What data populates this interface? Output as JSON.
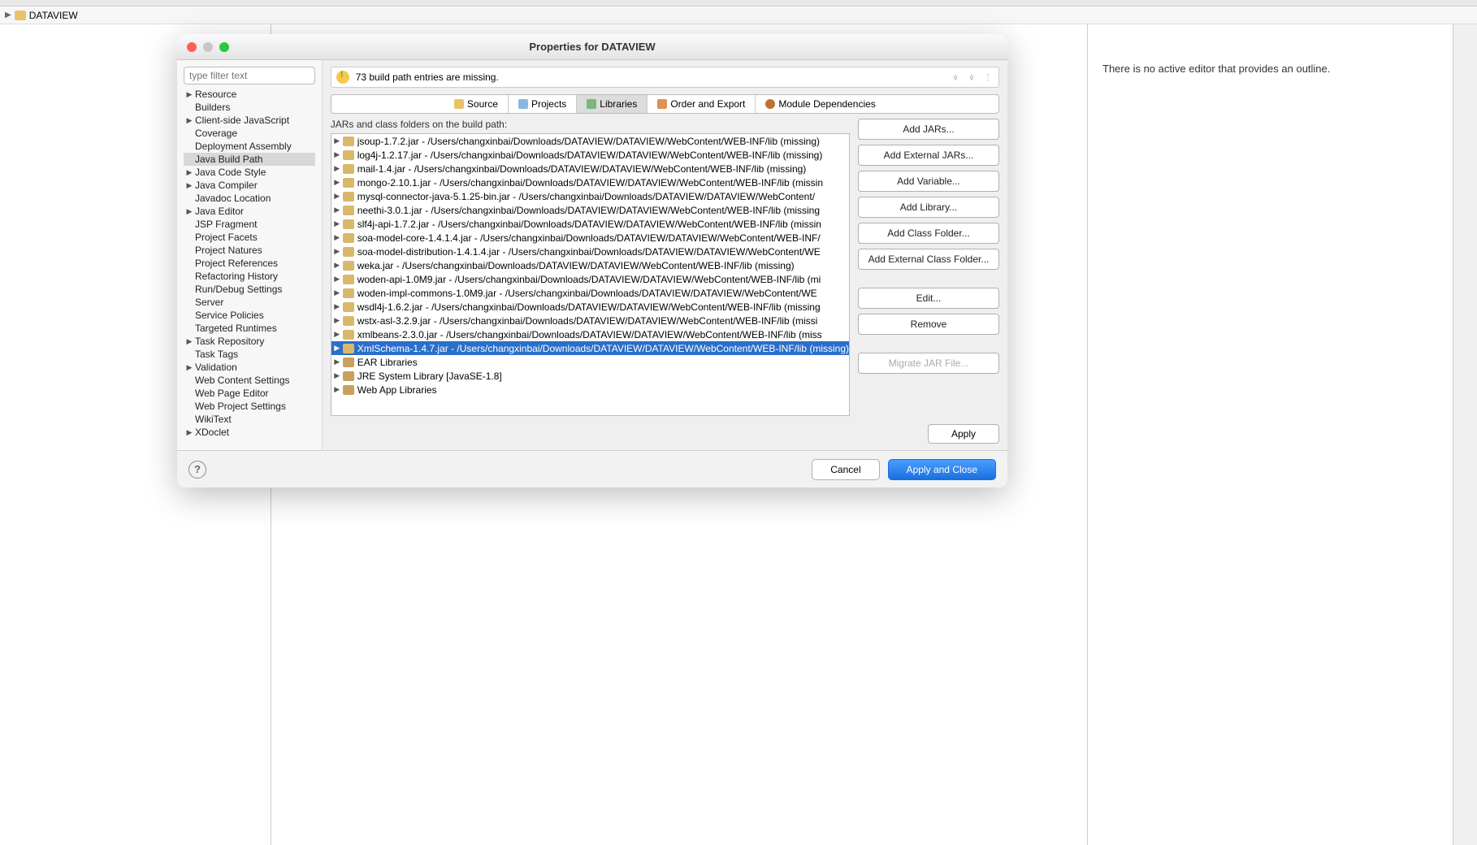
{
  "ide": {
    "project_name": "DATAVIEW",
    "outline_text": "There is no active editor that provides an outline."
  },
  "dialog": {
    "title": "Properties for DATAVIEW",
    "filter_placeholder": "type filter text",
    "alert_text": "73 build path entries are missing.",
    "sidebar": [
      {
        "label": "Resource",
        "expandable": true
      },
      {
        "label": "Builders",
        "expandable": false
      },
      {
        "label": "Client-side JavaScript",
        "expandable": true
      },
      {
        "label": "Coverage",
        "expandable": false
      },
      {
        "label": "Deployment Assembly",
        "expandable": false
      },
      {
        "label": "Java Build Path",
        "expandable": false,
        "selected": true
      },
      {
        "label": "Java Code Style",
        "expandable": true
      },
      {
        "label": "Java Compiler",
        "expandable": true
      },
      {
        "label": "Javadoc Location",
        "expandable": false
      },
      {
        "label": "Java Editor",
        "expandable": true
      },
      {
        "label": "JSP Fragment",
        "expandable": false
      },
      {
        "label": "Project Facets",
        "expandable": false
      },
      {
        "label": "Project Natures",
        "expandable": false
      },
      {
        "label": "Project References",
        "expandable": false
      },
      {
        "label": "Refactoring History",
        "expandable": false
      },
      {
        "label": "Run/Debug Settings",
        "expandable": false
      },
      {
        "label": "Server",
        "expandable": false
      },
      {
        "label": "Service Policies",
        "expandable": false
      },
      {
        "label": "Targeted Runtimes",
        "expandable": false
      },
      {
        "label": "Task Repository",
        "expandable": true
      },
      {
        "label": "Task Tags",
        "expandable": false
      },
      {
        "label": "Validation",
        "expandable": true
      },
      {
        "label": "Web Content Settings",
        "expandable": false
      },
      {
        "label": "Web Page Editor",
        "expandable": false
      },
      {
        "label": "Web Project Settings",
        "expandable": false
      },
      {
        "label": "WikiText",
        "expandable": false
      },
      {
        "label": "XDoclet",
        "expandable": true
      }
    ],
    "tabs": [
      {
        "label": "Source",
        "icon": "ti-src"
      },
      {
        "label": "Projects",
        "icon": "ti-proj"
      },
      {
        "label": "Libraries",
        "icon": "ti-lib",
        "active": true
      },
      {
        "label": "Order and Export",
        "icon": "ti-order"
      },
      {
        "label": "Module Dependencies",
        "icon": "ti-mod"
      }
    ],
    "list_label": "JARs and class folders on the build path:",
    "jars": [
      {
        "text": "jsoup-1.7.2.jar - /Users/changxinbai/Downloads/DATAVIEW/DATAVIEW/WebContent/WEB-INF/lib (missing)"
      },
      {
        "text": "log4j-1.2.17.jar - /Users/changxinbai/Downloads/DATAVIEW/DATAVIEW/WebContent/WEB-INF/lib (missing)"
      },
      {
        "text": "mail-1.4.jar - /Users/changxinbai/Downloads/DATAVIEW/DATAVIEW/WebContent/WEB-INF/lib (missing)"
      },
      {
        "text": "mongo-2.10.1.jar - /Users/changxinbai/Downloads/DATAVIEW/DATAVIEW/WebContent/WEB-INF/lib (missin"
      },
      {
        "text": "mysql-connector-java-5.1.25-bin.jar - /Users/changxinbai/Downloads/DATAVIEW/DATAVIEW/WebContent/"
      },
      {
        "text": "neethi-3.0.1.jar - /Users/changxinbai/Downloads/DATAVIEW/DATAVIEW/WebContent/WEB-INF/lib (missing"
      },
      {
        "text": "slf4j-api-1.7.2.jar - /Users/changxinbai/Downloads/DATAVIEW/DATAVIEW/WebContent/WEB-INF/lib (missin"
      },
      {
        "text": "soa-model-core-1.4.1.4.jar - /Users/changxinbai/Downloads/DATAVIEW/DATAVIEW/WebContent/WEB-INF/"
      },
      {
        "text": "soa-model-distribution-1.4.1.4.jar - /Users/changxinbai/Downloads/DATAVIEW/DATAVIEW/WebContent/WE"
      },
      {
        "text": "weka.jar - /Users/changxinbai/Downloads/DATAVIEW/DATAVIEW/WebContent/WEB-INF/lib (missing)"
      },
      {
        "text": "woden-api-1.0M9.jar - /Users/changxinbai/Downloads/DATAVIEW/DATAVIEW/WebContent/WEB-INF/lib (mi"
      },
      {
        "text": "woden-impl-commons-1.0M9.jar - /Users/changxinbai/Downloads/DATAVIEW/DATAVIEW/WebContent/WE"
      },
      {
        "text": "wsdl4j-1.6.2.jar - /Users/changxinbai/Downloads/DATAVIEW/DATAVIEW/WebContent/WEB-INF/lib (missing"
      },
      {
        "text": "wstx-asl-3.2.9.jar - /Users/changxinbai/Downloads/DATAVIEW/DATAVIEW/WebContent/WEB-INF/lib (missi"
      },
      {
        "text": "xmlbeans-2.3.0.jar - /Users/changxinbai/Downloads/DATAVIEW/DATAVIEW/WebContent/WEB-INF/lib (miss"
      },
      {
        "text": "XmlSchema-1.4.7.jar - /Users/changxinbai/Downloads/DATAVIEW/DATAVIEW/WebContent/WEB-INF/lib (missing)",
        "selected": true
      },
      {
        "text": "EAR Libraries",
        "lib": true
      },
      {
        "text": "JRE System Library [JavaSE-1.8]",
        "lib": true
      },
      {
        "text": "Web App Libraries",
        "lib": true
      }
    ],
    "buttons": {
      "add_jars": "Add JARs...",
      "add_ext_jars": "Add External JARs...",
      "add_variable": "Add Variable...",
      "add_library": "Add Library...",
      "add_class_folder": "Add Class Folder...",
      "add_ext_class_folder": "Add External Class Folder...",
      "edit": "Edit...",
      "remove": "Remove",
      "migrate": "Migrate JAR File...",
      "apply": "Apply",
      "cancel": "Cancel",
      "apply_close": "Apply and Close"
    }
  }
}
